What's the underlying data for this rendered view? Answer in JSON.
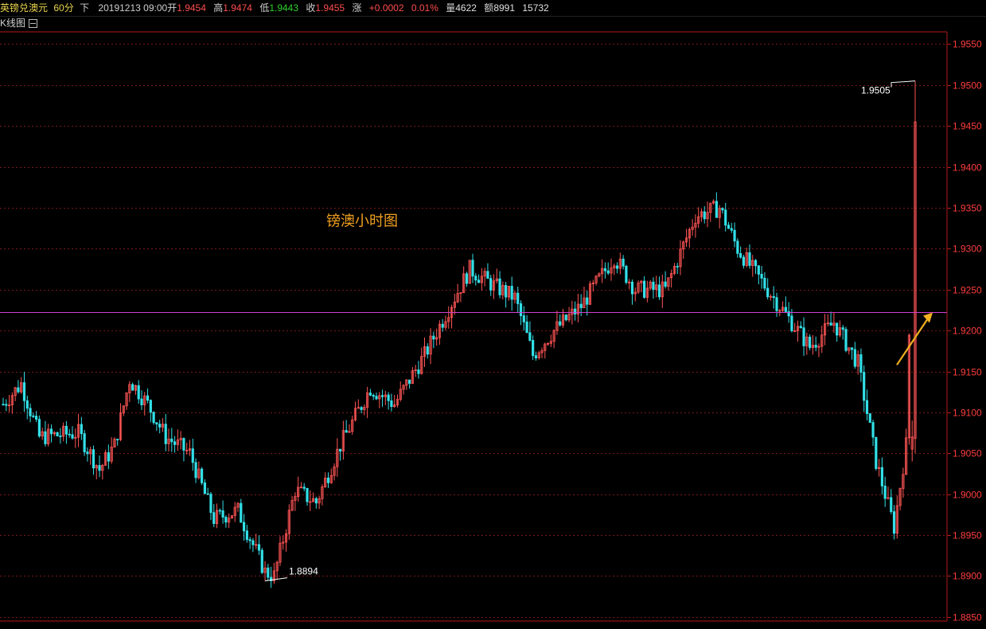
{
  "header": {
    "symbol": "英镑兑澳元",
    "period": "60分",
    "direction": "下",
    "datetime": "20191213 09:00",
    "open_label": "开",
    "open": "1.9454",
    "high_label": "高",
    "high": "1.9474",
    "low_label": "低",
    "low": "1.9443",
    "close_label": "收",
    "close": "1.9455",
    "change_label": "涨",
    "change": "+0.0002",
    "change_pct": "0.01%",
    "volume_label": "量",
    "volume": "4622",
    "amount_label": "额",
    "amount": "8991",
    "extra": "15732"
  },
  "subheader": {
    "label": "K线图"
  },
  "colors": {
    "up": "#ff5555",
    "down": "#33e0e8",
    "grid": "#7a1818",
    "axis": "#b51a1a",
    "axis_text": "#ff3d3d",
    "hline": "#d040d0",
    "annotation_text": "#ffffff",
    "title_text": "#f0a020",
    "arrow": "#f0b020"
  },
  "chart_data": {
    "type": "candlestick",
    "title": "镑澳小时图",
    "ylim": [
      1.8845,
      1.9565
    ],
    "y_ticks": [
      "1.9550",
      "1.9500",
      "1.9450",
      "1.9400",
      "1.9350",
      "1.9300",
      "1.9250",
      "1.9200",
      "1.9150",
      "1.9100",
      "1.9050",
      "1.9000",
      "1.8950",
      "1.8900",
      "1.8850"
    ],
    "horizontal_line": 1.9222,
    "annotations": [
      {
        "text": "1.9505",
        "value": 1.9505,
        "kind": "high"
      },
      {
        "text": "1.8894",
        "value": 1.8894,
        "kind": "low"
      }
    ],
    "grid": true,
    "anchors": [
      [
        0,
        1.911
      ],
      [
        6,
        1.9135
      ],
      [
        12,
        1.907
      ],
      [
        25,
        1.9075
      ],
      [
        32,
        1.903
      ],
      [
        37,
        1.906
      ],
      [
        42,
        1.914
      ],
      [
        48,
        1.911
      ],
      [
        54,
        1.907
      ],
      [
        62,
        1.905
      ],
      [
        70,
        1.897
      ],
      [
        78,
        1.898
      ],
      [
        87,
        1.8905
      ],
      [
        90,
        1.89
      ],
      [
        97,
        1.9005
      ],
      [
        104,
        1.899
      ],
      [
        112,
        1.906
      ],
      [
        122,
        1.913
      ],
      [
        130,
        1.911
      ],
      [
        140,
        1.917
      ],
      [
        147,
        1.922
      ],
      [
        155,
        1.9275
      ],
      [
        163,
        1.9255
      ],
      [
        170,
        1.924
      ],
      [
        176,
        1.917
      ],
      [
        183,
        1.92
      ],
      [
        192,
        1.923
      ],
      [
        203,
        1.929
      ],
      [
        210,
        1.925
      ],
      [
        220,
        1.925
      ],
      [
        230,
        1.934
      ],
      [
        238,
        1.935
      ],
      [
        244,
        1.93
      ],
      [
        252,
        1.926
      ],
      [
        260,
        1.922
      ],
      [
        268,
        1.918
      ],
      [
        276,
        1.921
      ],
      [
        284,
        1.916
      ],
      [
        290,
        1.904
      ],
      [
        296,
        1.896
      ],
      [
        300,
        1.906
      ],
      [
        303,
        1.9465
      ]
    ]
  }
}
